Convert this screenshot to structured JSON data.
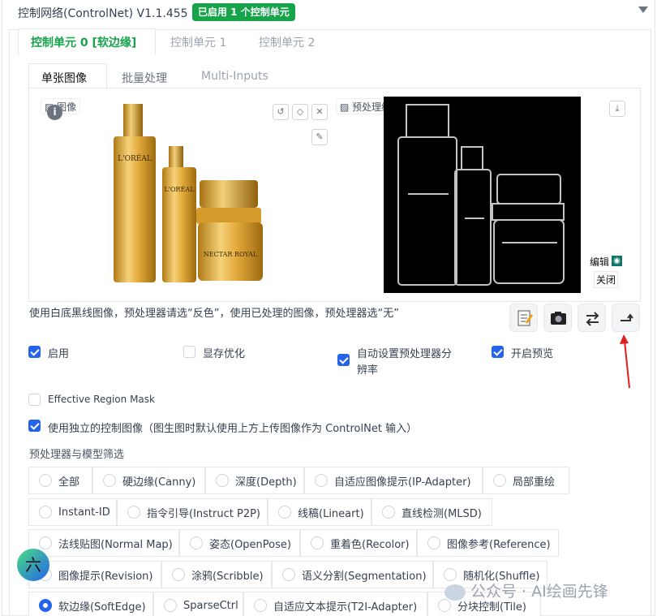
{
  "header": {
    "title": "控制网络(ControlNet) V1.1.455",
    "badge": "已启用 1 个控制单元"
  },
  "unit_tabs": [
    "控制单元 0 [软边缘]",
    "控制单元 1",
    "控制单元 2"
  ],
  "sub_tabs": [
    "单张图像",
    "批量处理",
    "Multi-Inputs"
  ],
  "image_panel": {
    "label": "图像",
    "product_text_1": "L'ORÉAL",
    "product_text_2": "L'ORÉAL",
    "product_text_3": "NECTAR ROYAL"
  },
  "preview_panel": {
    "label": "预处理结果预览",
    "edit_label": "编辑",
    "close_label": "关闭"
  },
  "hint": "使用白底黑线图像，预处理器请选“反色”，使用已处理的图像，预处理器选“无”",
  "checkboxes": {
    "enable": "启用",
    "lowvram": "显存优化",
    "pixel_perfect": "自动设置预处理器分",
    "pixel_perfect_2": "辨率",
    "preview": "开启预览",
    "region_mask": "Effective Region Mask",
    "independent": "使用独立的控制图像（图生图时默认使用上方上传图像作为 ControlNet 输入）"
  },
  "filter_label": "预处理器与模型筛选",
  "filters": [
    "全部",
    "硬边缘(Canny)",
    "深度(Depth)",
    "自适应图像提示(IP-Adapter)",
    "局部重绘",
    "Instant-ID",
    "指令引导(Instruct P2P)",
    "线稿(Lineart)",
    "直线检测(MLSD)",
    "法线贴图(Normal Map)",
    "姿态(OpenPose)",
    "重着色(Recolor)",
    "图像参考(Reference)",
    "图像提示(Revision)",
    "涂鸦(Scribble)",
    "语义分割(Segmentation)",
    "随机化(Shuffle)",
    "软边缘(SoftEdge)",
    "SparseCtrl",
    "自适应文本提示(T2I-Adapter)",
    "分块控制(Tile)"
  ],
  "selected_filter": "软边缘(SoftEdge)",
  "avatar_char": "六",
  "watermark": "公众号 · AI绘画先锋"
}
